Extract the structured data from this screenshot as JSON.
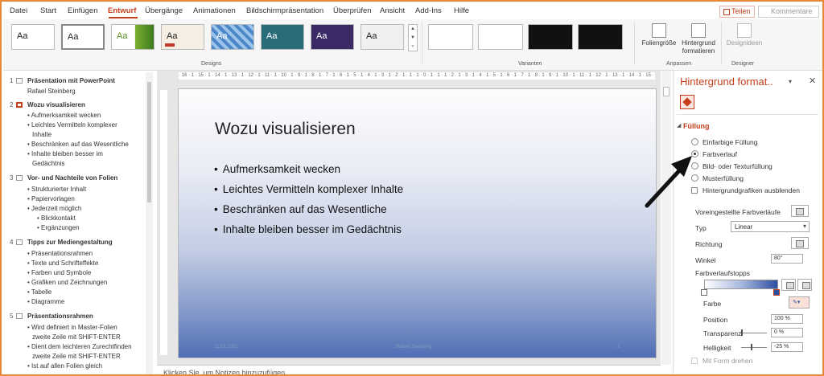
{
  "menu": {
    "tabs": [
      "Datei",
      "Start",
      "Einfügen",
      "Entwurf",
      "Übergänge",
      "Animationen",
      "Bildschirmpräsentation",
      "Überprüfen",
      "Ansicht",
      "Add-Ins",
      "Hilfe"
    ],
    "share": "Teilen",
    "comments": "Kommentare"
  },
  "ribbon": {
    "theme_label": "Aa",
    "designs_label": "Designs",
    "variants_label": "Varianten",
    "slide_size": "Foliengröße",
    "format_bg_1": "Hintergrund",
    "format_bg_2": "formatieren",
    "customize_label": "Anpassen",
    "designer_btn": "Designideen",
    "designer_label": "Designer"
  },
  "outline": {
    "slides": [
      {
        "num": "1",
        "title": "Präsentation mit PowerPoint",
        "subtitle": "Rafael Steinberg",
        "items": []
      },
      {
        "num": "2",
        "title": "Wozu visualisieren",
        "items": [
          "Aufmerksamkeit wecken",
          "Leichtes Vermitteln komplexer",
          "Inhalte",
          "Beschränken auf das Wesentliche",
          "Inhalte bleiben besser im",
          "Gedächtnis"
        ]
      },
      {
        "num": "3",
        "title": "Vor- und Nachteile von Folien",
        "items": [
          "Strukturierter Inhalt",
          "Papiervorlagen",
          "Jederzeit möglich",
          "Blickkontakt",
          "Ergänzungen"
        ]
      },
      {
        "num": "4",
        "title": "Tipps zur Mediengestaltung",
        "items": [
          "Präsentationsrahmen",
          "Texte und Schrifteffekte",
          "Farben und Symbole",
          "Grafiken und Zeichnungen",
          "Tabelle",
          "Diagramme"
        ]
      },
      {
        "num": "5",
        "title": "Präsentationsrahmen",
        "items": [
          "Wird definiert in Master-Folien",
          "zweite Zeile mit SHIFT-ENTER",
          "Dient dem leichteren Zurechtfinden",
          "zweite Zeile mit SHIFT-ENTER",
          "Ist auf allen Folien gleich"
        ]
      }
    ]
  },
  "slide": {
    "title": "Wozu visualisieren",
    "bullets": [
      "Aufmerksamkeit wecken",
      "Leichtes Vermitteln komplexer Inhalte",
      "Beschränken auf das Wesentliche",
      "Inhalte bleiben besser im Gedächtnis"
    ],
    "footer_date": "11.03.2021",
    "footer_center": "Rafael Steinberg",
    "footer_num": "2"
  },
  "ruler": {
    "h": "· 16 · 1 · 15 · 1 · 14 · 1 · 13 · 1 · 12 · 1 · 11 · 1 · 10 · 1 · 9 · 1 · 8 · 1 · 7 · 1 · 6 · 1 · 5 · 1 · 4 · 1 · 3 · 1 · 2 · 1 · 1 · 1 · 0 · 1 · 1 · 1 · 2 · 1 · 3 · 1 · 4 · 1 · 5 · 1 · 6 · 1 · 7 · 1 · 8 · 1 · 9 · 1 · 10 · 1 · 11 · 1 · 12 · 1 · 13 · 1 · 14 · 1 · 15 · 1 · 16"
  },
  "notes": "Klicken Sie, um Notizen hinzuzufügen",
  "pane": {
    "title": "Hintergrund format..",
    "menu": "▾",
    "close": "✕",
    "section": "Füllung",
    "options": [
      "Einfarbige Füllung",
      "Farbverlauf",
      "Bild- oder Texturfüllung",
      "Musterfüllung"
    ],
    "hide_graphics": "Hintergrundgrafiken ausblenden",
    "preset": "Voreingestellte Farbverläufe",
    "type_label": "Typ",
    "type_value": "Linear",
    "direction": "Richtung",
    "angle_label": "Winkel",
    "angle_value": "80°",
    "stops_label": "Farbverlaufstopps",
    "color_label": "Farbe",
    "position_label": "Position",
    "position_value": "100 %",
    "transparency_label": "Transparenz",
    "transparency_value": "0 %",
    "brightness_label": "Helligkeit",
    "brightness_value": "-25 %",
    "rotate_label": "Mit Form drehen"
  },
  "colors": {
    "accent": "#c43e1c",
    "frame": "#e8893a",
    "slide_bottom": "#4f6eb4"
  }
}
